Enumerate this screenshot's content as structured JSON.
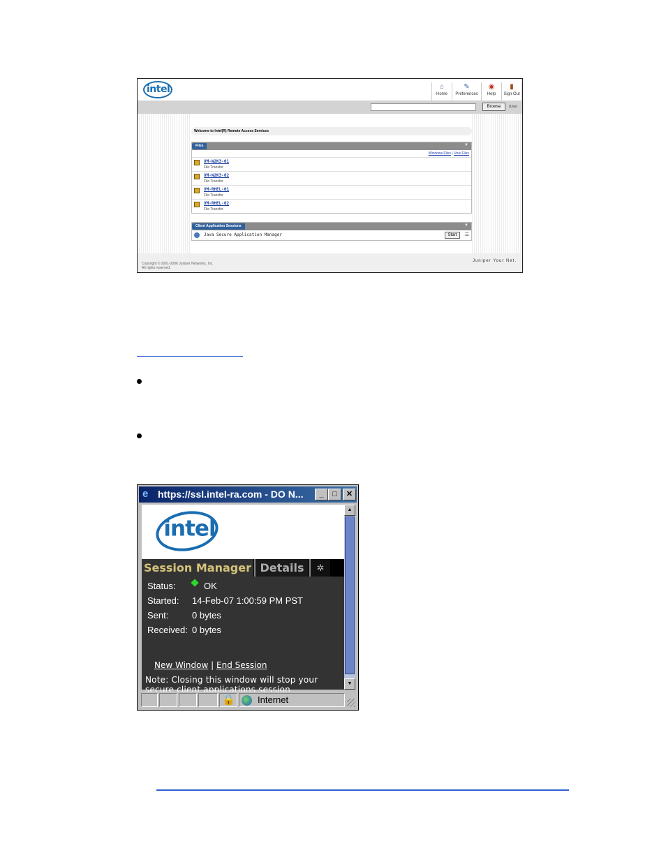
{
  "portal": {
    "logo_text": "intel",
    "nav": [
      {
        "label": "Home",
        "icon": "home-icon"
      },
      {
        "label": "Preferences",
        "icon": "wrench-icon"
      },
      {
        "label": "Help",
        "icon": "lifebuoy-icon"
      },
      {
        "label": "Sign Out",
        "icon": "door-icon"
      }
    ],
    "browse_label": "Browse",
    "user_link": "(Use)",
    "welcome": "Welcome to Intel(R) Remote Access Services",
    "files_title": "Files",
    "files_links": {
      "windows": "Windows Files",
      "sep": "|",
      "unix": "Unix Files"
    },
    "files": [
      {
        "name": "VM-W2K3-01",
        "type": "File Transfer"
      },
      {
        "name": "VM-W2K3-02",
        "type": "File Transfer"
      },
      {
        "name": "VM-RHEL-01",
        "type": "File Transfer"
      },
      {
        "name": "VM-RHEL-02",
        "type": "File Transfer"
      }
    ],
    "apps_title": "Client Application Sessions",
    "app_name": "Java Secure Application Manager",
    "start_label": "Start",
    "copyright_1": "Copyright © 2001-2006 Juniper Networks, Inc.",
    "copyright_2": "All rights reserved.",
    "brand": "Juniper Your Net."
  },
  "session_window": {
    "title": "https://ssl.intel-ra.com - DO N...",
    "logo_text": "intel",
    "tab_session": "Session Manager",
    "tab_details": "Details",
    "rows": [
      {
        "label": "Status:",
        "value": "OK"
      },
      {
        "label": "Started:",
        "value": "14-Feb-07 1:00:59 PM PST"
      },
      {
        "label": "Sent:",
        "value": "0 bytes"
      },
      {
        "label": "Received:",
        "value": "0 bytes"
      }
    ],
    "link_new": "New Window",
    "link_sep": "|",
    "link_end": "End Session",
    "note": "Note: Closing this window will stop your secure client applications session",
    "zone": "Internet"
  }
}
